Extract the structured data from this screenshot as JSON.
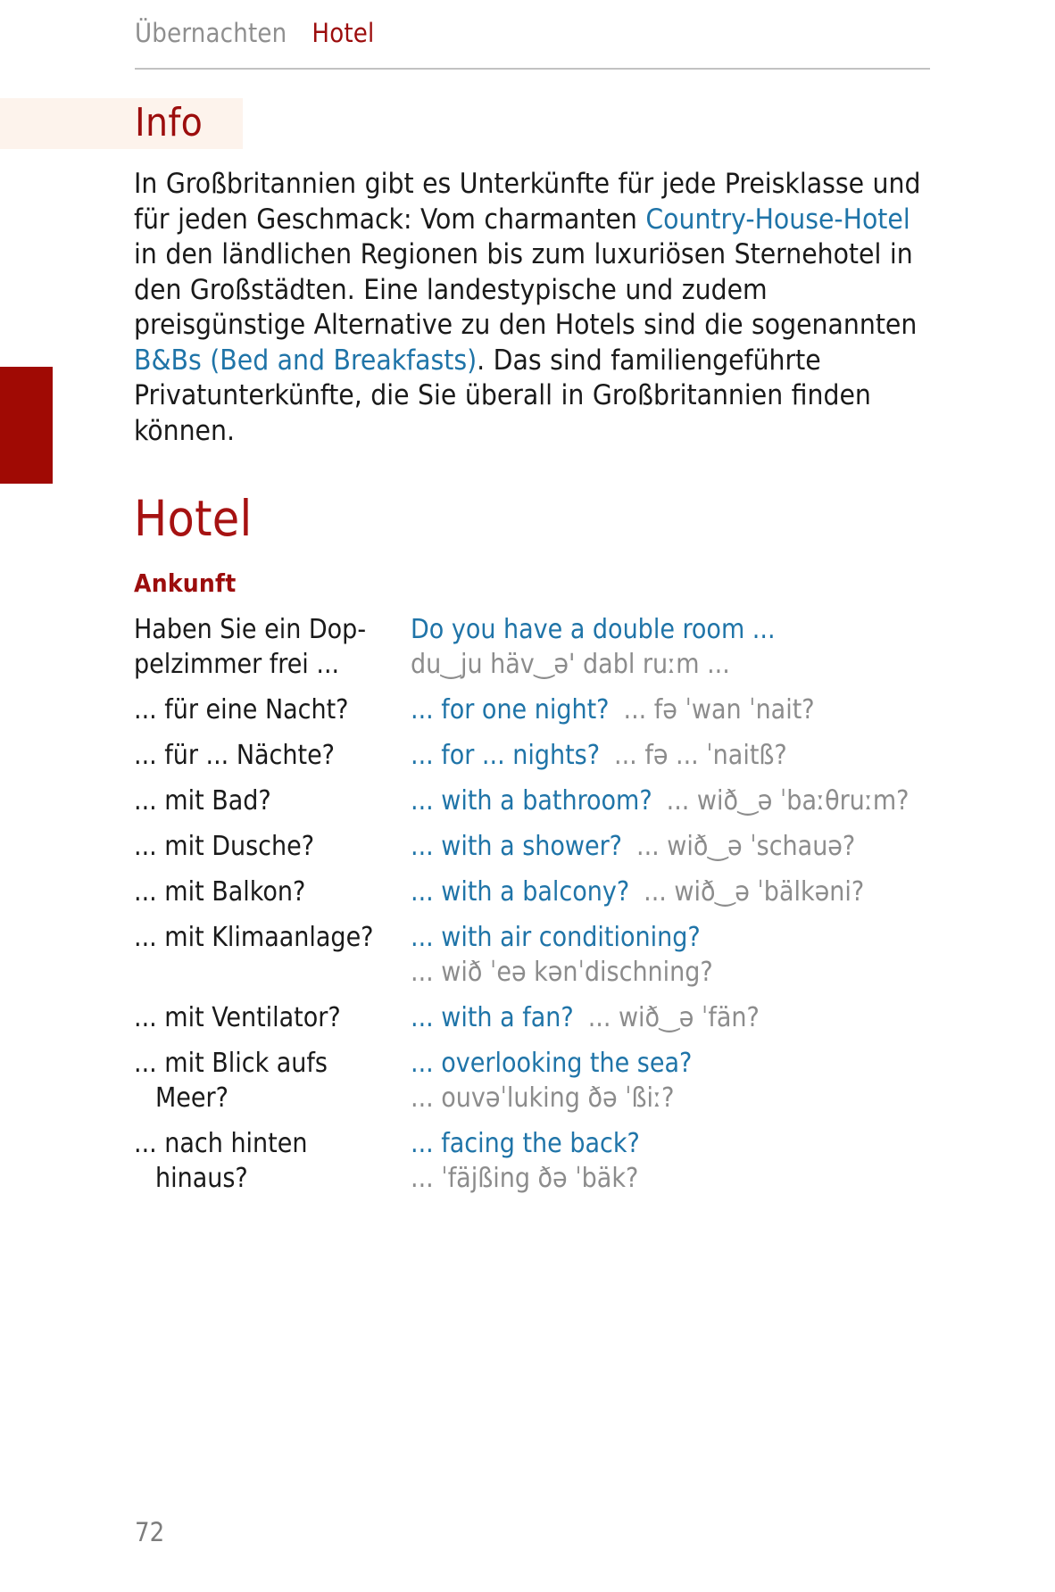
{
  "header": {
    "section": "Übernachten",
    "topic": "Hotel"
  },
  "info": {
    "title": "Info",
    "paragraph_segments": [
      {
        "text": "In Großbritannien gibt es Unterkünfte für jede Preisklasse und für jeden Geschmack: Vom charmanten ",
        "highlight": false
      },
      {
        "text": "Country-House-Hotel",
        "highlight": true
      },
      {
        "text": " in den ländlichen Regionen bis zum luxuriösen Sternehotel in den Großstädten. Eine landestypische und zudem preisgünstige Alternative zu den Hotels sind die sogenannten ",
        "highlight": false
      },
      {
        "text": "B&Bs (Bed and Breakfasts)",
        "highlight": true
      },
      {
        "text": ". Das sind familiengeführte Privatunterkünfte, die Sie überall in Großbritannien finden können.",
        "highlight": false
      }
    ]
  },
  "section": {
    "title": "Hotel",
    "subtitle": "Ankunft"
  },
  "phrases": [
    {
      "de_line1": "Haben Sie ein Dop-",
      "de_line2": "pelzimmer frei ...",
      "de_indent2": false,
      "en": "Do you have a double room ...",
      "pron": "du‿ju häv‿ə' dabl ruːm ...",
      "pron_position": "block"
    },
    {
      "de_line1": "... für eine Nacht?",
      "de_line2": "",
      "de_indent2": false,
      "en": "... for one night?",
      "pron": "... fə ˈwan ˈnait?",
      "pron_position": "inline"
    },
    {
      "de_line1": "... für ... Nächte?",
      "de_line2": "",
      "de_indent2": false,
      "en": "... for ... nights?",
      "pron": "... fə ... ˈnaitß?",
      "pron_position": "inline"
    },
    {
      "de_line1": "... mit Bad?",
      "de_line2": "",
      "de_indent2": false,
      "en": "... with a bathroom?",
      "pron": "... wið‿ə ˈbaːθruːm?",
      "pron_position": "inline"
    },
    {
      "de_line1": "... mit Dusche?",
      "de_line2": "",
      "de_indent2": false,
      "en": "... with a shower?",
      "pron": "... wið‿ə ˈschauə?",
      "pron_position": "inline"
    },
    {
      "de_line1": "... mit Balkon?",
      "de_line2": "",
      "de_indent2": false,
      "en": "... with a balcony?",
      "pron": "... wið‿ə ˈbälkəni?",
      "pron_position": "inline"
    },
    {
      "de_line1": "... mit Klimaanlage?",
      "de_line2": "",
      "de_indent2": false,
      "en": "... with air conditioning?",
      "pron": "... wið ˈeə kənˈdischning?",
      "pron_position": "block"
    },
    {
      "de_line1": "... mit Ventilator?",
      "de_line2": "",
      "de_indent2": false,
      "en": "... with a fan?",
      "pron": "... wið‿ə ˈfän?",
      "pron_position": "inline"
    },
    {
      "de_line1": "... mit Blick aufs",
      "de_line2": "Meer?",
      "de_indent2": true,
      "en": "... overlooking the sea?",
      "pron": "... ouvəˈluking ðə ˈßiː?",
      "pron_position": "block"
    },
    {
      "de_line1": "... nach hinten",
      "de_line2": "hinaus?",
      "de_indent2": true,
      "en": "... facing the back?",
      "pron": "... ˈfäjßing ðə ˈbäk?",
      "pron_position": "block"
    }
  ],
  "folio": {
    "page_number": "72"
  },
  "colors": {
    "accent_red": "#9c0d0d",
    "tab_red": "#a00a04",
    "link_blue": "#1f74a8",
    "pron_gray": "#8c8c8c",
    "header_gray": "#8f8f8f",
    "info_band": "#fdf3ec"
  }
}
